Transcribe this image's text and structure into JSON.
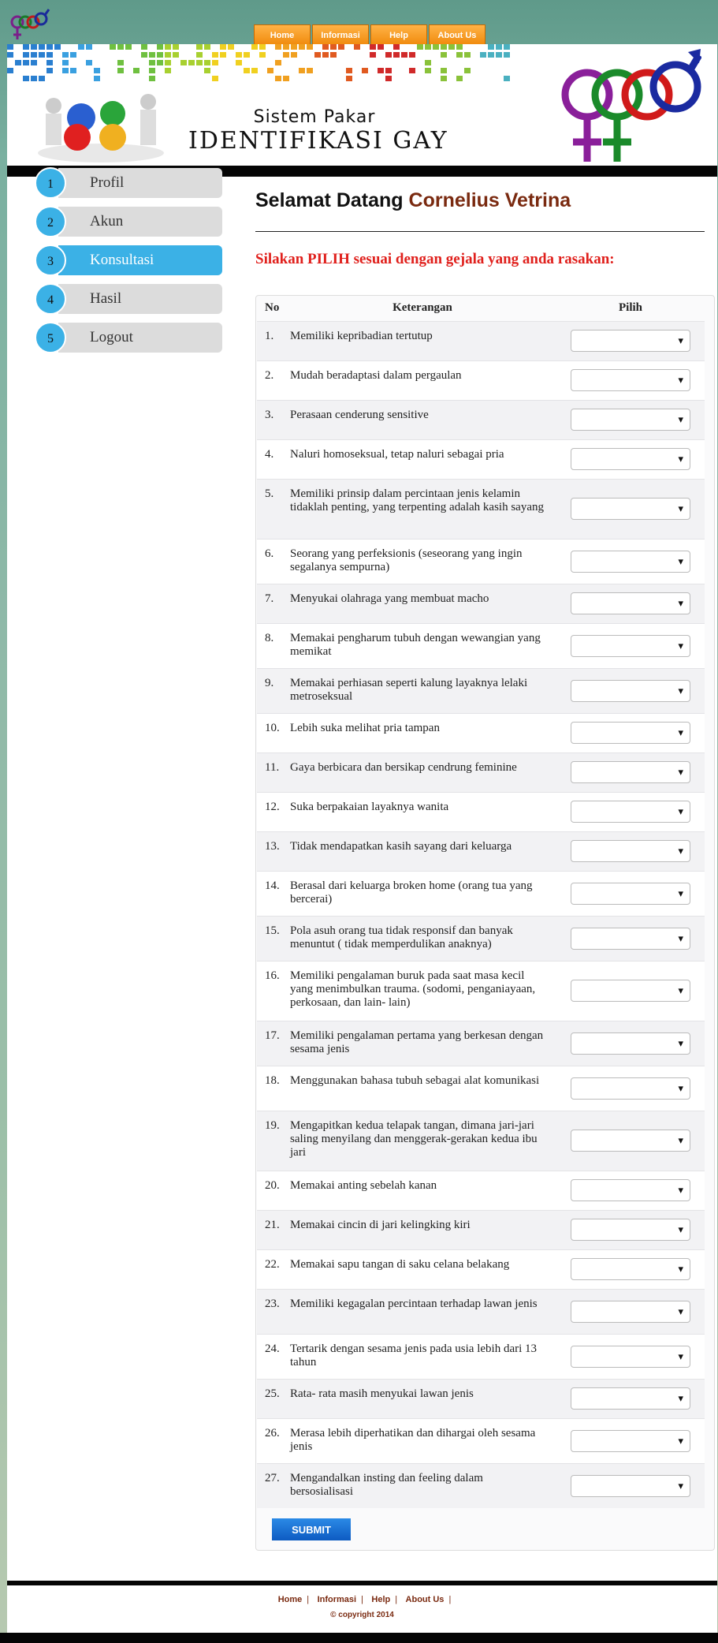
{
  "nav": {
    "items": [
      "Home",
      "Informasi",
      "Help",
      "About Us"
    ]
  },
  "banner": {
    "subtitle": "Sistem Pakar",
    "title": "IDENTIFIKASI GAY"
  },
  "sidebar": {
    "items": [
      {
        "num": "1",
        "label": "Profil"
      },
      {
        "num": "2",
        "label": "Akun"
      },
      {
        "num": "3",
        "label": "Konsultasi"
      },
      {
        "num": "4",
        "label": "Hasil"
      },
      {
        "num": "5",
        "label": "Logout"
      }
    ],
    "active_index": 2
  },
  "welcome": {
    "prefix": "Selamat Datang",
    "name": "Cornelius Vetrina"
  },
  "instruction": "Silakan PILIH sesuai dengan gejala yang anda rasakan:",
  "table": {
    "headers": {
      "no": "No",
      "ket": "Keterangan",
      "pilih": "Pilih"
    },
    "rows": [
      {
        "no": "1.",
        "text": "Memiliki kepribadian tertutup"
      },
      {
        "no": "2.",
        "text": "Mudah beradaptasi dalam pergaulan"
      },
      {
        "no": "3.",
        "text": "Perasaan cenderung sensitive"
      },
      {
        "no": "4.",
        "text": "Naluri homoseksual, tetap naluri sebagai pria"
      },
      {
        "no": "5.",
        "text": "Memiliki prinsip dalam percintaan jenis kelamin tidaklah penting, yang terpenting adalah kasih sayang"
      },
      {
        "no": "6.",
        "text": "Seorang yang perfeksionis (seseorang yang ingin segalanya sempurna)"
      },
      {
        "no": "7.",
        "text": "Menyukai olahraga yang membuat macho"
      },
      {
        "no": "8.",
        "text": "Memakai pengharum tubuh dengan wewangian yang memikat"
      },
      {
        "no": "9.",
        "text": "Memakai perhiasan seperti kalung layaknya lelaki metroseksual"
      },
      {
        "no": "10.",
        "text": "Lebih suka melihat pria tampan"
      },
      {
        "no": "11.",
        "text": "Gaya berbicara dan bersikap cendrung feminine"
      },
      {
        "no": "12.",
        "text": "Suka berpakaian layaknya wanita"
      },
      {
        "no": "13.",
        "text": "Tidak mendapatkan kasih sayang dari keluarga"
      },
      {
        "no": "14.",
        "text": "Berasal dari keluarga broken home (orang tua yang bercerai)"
      },
      {
        "no": "15.",
        "text": "Pola asuh orang tua tidak responsif dan banyak menuntut ( tidak memperdulikan anaknya)"
      },
      {
        "no": "16.",
        "text": "Memiliki pengalaman buruk pada saat masa kecil yang menimbulkan trauma. (sodomi, penganiayaan, perkosaan, dan lain- lain)"
      },
      {
        "no": "17.",
        "text": "Memiliki pengalaman pertama yang berkesan dengan sesama jenis"
      },
      {
        "no": "18.",
        "text": "Menggunakan bahasa tubuh sebagai alat komunikasi"
      },
      {
        "no": "19.",
        "text": "Mengapitkan kedua telapak tangan, dimana jari-jari saling menyilang dan menggerak-gerakan kedua ibu jari"
      },
      {
        "no": "20.",
        "text": "Memakai anting sebelah kanan"
      },
      {
        "no": "21.",
        "text": "Memakai cincin di jari kelingking kiri"
      },
      {
        "no": "22.",
        "text": "Memakai sapu tangan di saku celana belakang"
      },
      {
        "no": "23.",
        "text": "Memiliki kegagalan percintaan terhadap lawan jenis"
      },
      {
        "no": "24.",
        "text": "Tertarik dengan sesama jenis pada usia lebih dari 13 tahun"
      },
      {
        "no": "25.",
        "text": "Rata- rata masih menyukai lawan jenis"
      },
      {
        "no": "26.",
        "text": "Merasa lebih diperhatikan dan dihargai oleh sesama jenis"
      },
      {
        "no": "27.",
        "text": "Mengandalkan insting dan feeling dalam bersosialisasi"
      }
    ]
  },
  "submit_label": "SUBMIT",
  "footer": {
    "links": [
      "Home",
      "Informasi",
      "Help",
      "About Us"
    ],
    "copyright": "© copyright 2014"
  },
  "colors": {
    "accent_blue": "#3bb1e6",
    "nav_orange": "#f08a0c",
    "instruction_red": "#e0201c",
    "name_brown": "#7a2a10"
  },
  "icons": [
    "gender-symbols-icon",
    "gears-team-icon",
    "dropdown-arrow-icon"
  ]
}
